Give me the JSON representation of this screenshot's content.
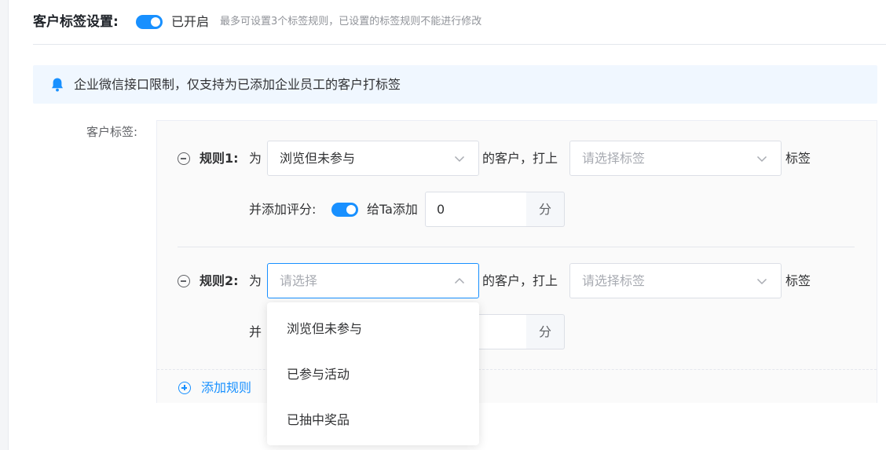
{
  "header": {
    "title": "客户标签设置:",
    "toggle_state": "已开启",
    "hint": "最多可设置3个标签规则，已设置的标签规则不能进行修改"
  },
  "alert": {
    "text": "企业微信接口限制，仅支持为已添加企业员工的客户打标签",
    "icon": "bell-icon"
  },
  "form": {
    "field_label": "客户标签:",
    "rules": [
      {
        "label": "规则1:",
        "for_text": "为",
        "select_value": "浏览但未参与",
        "mid_text": "的客户，打上",
        "tag_placeholder": "请选择标签",
        "suffix": "标签",
        "score_label": "并添加评分:",
        "score_toggle_text": "给Ta添加",
        "score_value": "0",
        "score_unit": "分"
      },
      {
        "label": "规则2:",
        "for_text": "为",
        "select_placeholder": "请选择",
        "mid_text": "的客户，打上",
        "tag_placeholder": "请选择标签",
        "suffix": "标签",
        "score_label_partial": "并",
        "score_unit": "分"
      }
    ],
    "add_rule": "添加规则"
  },
  "dropdown": {
    "options": [
      "浏览但未参与",
      "已参与活动",
      "已抽中奖品"
    ]
  },
  "colors": {
    "accent": "#1890ff",
    "alert_bg": "#f0f7ff"
  }
}
